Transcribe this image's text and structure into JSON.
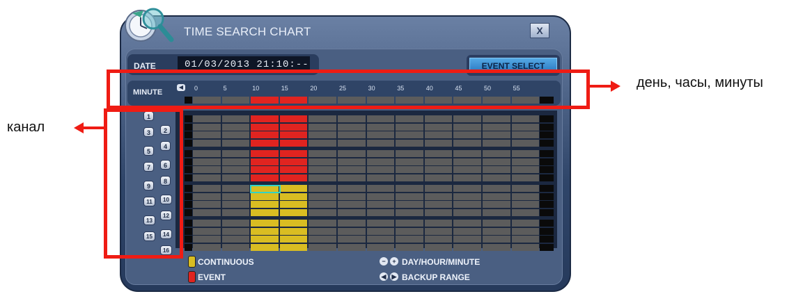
{
  "window": {
    "title": "TIME SEARCH CHART",
    "close_label": "X"
  },
  "date": {
    "label": "DATE",
    "value": "01/03/2013 21:10:--"
  },
  "event_select": {
    "label": "EVENT SELECT"
  },
  "minute": {
    "label": "MINUTE",
    "ticks": [
      "0",
      "5",
      "10",
      "15",
      "20",
      "25",
      "30",
      "35",
      "40",
      "45",
      "50",
      "55"
    ]
  },
  "channels": [
    "1",
    "2",
    "3",
    "4",
    "5",
    "6",
    "7",
    "8",
    "9",
    "10",
    "11",
    "12",
    "13",
    "14",
    "15",
    "16"
  ],
  "legend": {
    "continuous": "CONTINUOUS",
    "event": "EVENT",
    "day_hour_minute": "DAY/HOUR/MINUTE",
    "backup_range": "BACKUP RANGE"
  },
  "annotations": {
    "right": "день, часы, минуты",
    "left": "канал"
  },
  "colors": {
    "continuous": "#d9bd22",
    "event": "#e02420",
    "empty": "#5c5c5c",
    "highlight": "#ef1c14",
    "selection": "#32d4c8"
  },
  "recording": {
    "top_strip": "event",
    "channel_types": [
      "event",
      "event",
      "event",
      "event",
      "event",
      "event",
      "event",
      "event",
      "continuous",
      "continuous",
      "continuous",
      "continuous",
      "continuous",
      "continuous",
      "continuous",
      "continuous"
    ],
    "recorded_segments": [
      2,
      3
    ],
    "selected_channel": "9"
  }
}
